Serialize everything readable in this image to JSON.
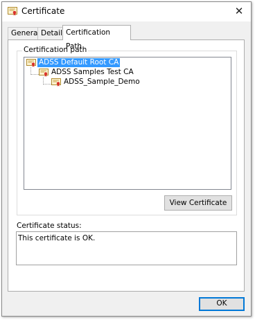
{
  "window": {
    "title": "Certificate",
    "close_glyph": "✕"
  },
  "tabs": [
    {
      "label": "General",
      "active": false
    },
    {
      "label": "Details",
      "active": false
    },
    {
      "label": "Certification Path",
      "active": true
    }
  ],
  "certification_path": {
    "group_label": "Certification path",
    "nodes": [
      {
        "label": "ADSS Default Root CA",
        "level": 0,
        "selected": true,
        "icon": "certificate-icon"
      },
      {
        "label": "ADSS Samples Test CA",
        "level": 1,
        "selected": false,
        "icon": "certificate-icon"
      },
      {
        "label": "ADSS_Sample_Demo",
        "level": 2,
        "selected": false,
        "icon": "certificate-icon"
      }
    ],
    "view_certificate_label": "View Certificate"
  },
  "status": {
    "label": "Certificate status:",
    "text": "This certificate is OK."
  },
  "footer": {
    "ok_label": "OK"
  },
  "colors": {
    "selection": "#3399ff",
    "window_bg": "#f0f0f0",
    "default_button_border": "#0078d7"
  }
}
